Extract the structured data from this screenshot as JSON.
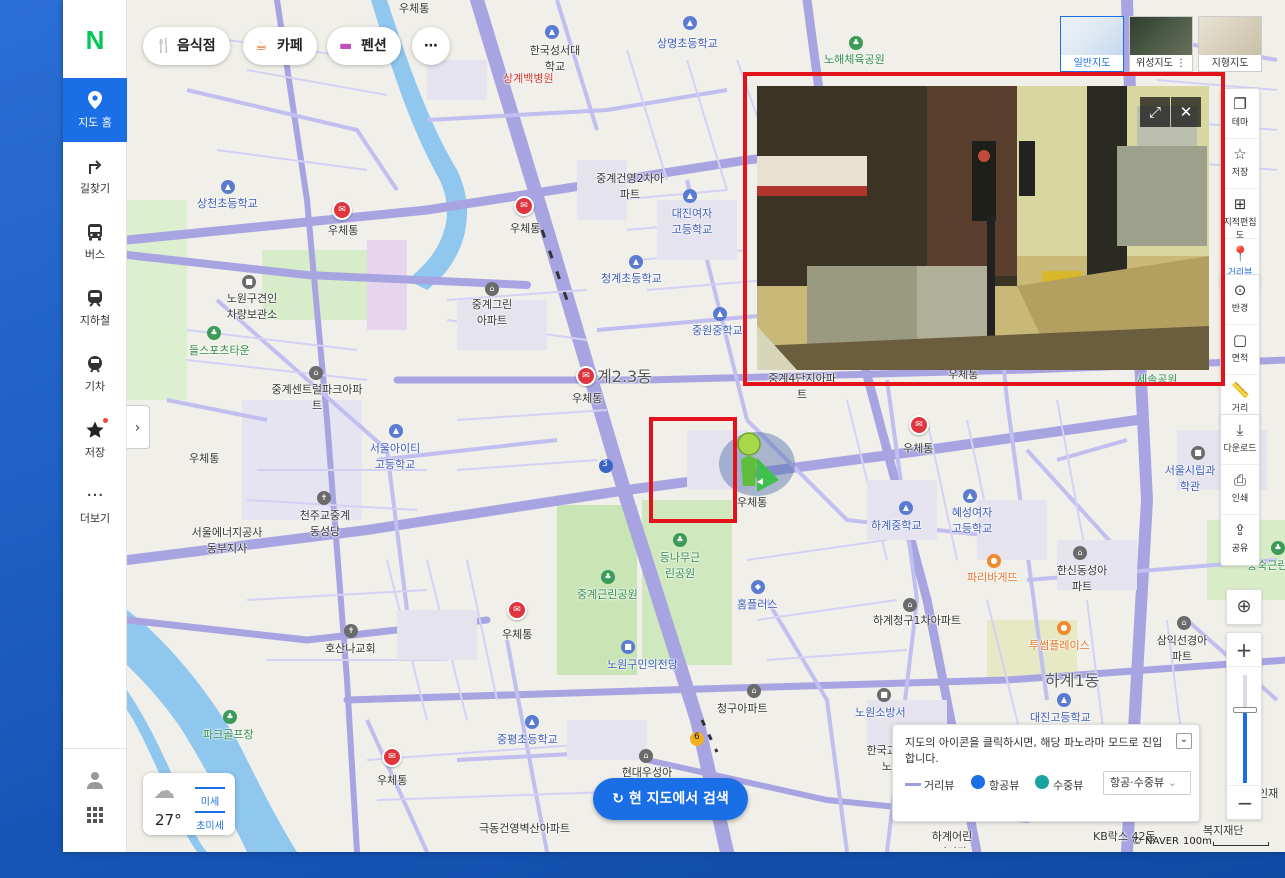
{
  "nav": {
    "logo": "N",
    "items": [
      {
        "label": "지도 홈",
        "icon": "location-pin-icon"
      },
      {
        "label": "길찾기",
        "icon": "directions-arrow-icon"
      },
      {
        "label": "버스",
        "icon": "bus-icon"
      },
      {
        "label": "지하철",
        "icon": "subway-icon"
      },
      {
        "label": "기차",
        "icon": "train-icon"
      },
      {
        "label": "저장",
        "icon": "star-icon"
      },
      {
        "label": "더보기",
        "icon": "more-dots-icon"
      }
    ]
  },
  "categories": [
    {
      "label": "음식점",
      "icon": "fork-knife-icon"
    },
    {
      "label": "카페",
      "icon": "coffee-cup-icon"
    },
    {
      "label": "펜션",
      "icon": "bed-icon"
    },
    {
      "label": "⋯",
      "icon": "more-icon"
    }
  ],
  "layers": [
    {
      "label": "일반지도",
      "active": true
    },
    {
      "label": "위성지도 ⋮",
      "active": false
    },
    {
      "label": "지형지도",
      "active": false
    }
  ],
  "tools_top": [
    {
      "label": "테마",
      "icon": "layers-icon"
    },
    {
      "label": "저장",
      "icon": "star-outline-icon"
    },
    {
      "label": "지적편집도",
      "icon": "grid-icon"
    },
    {
      "label": "거리뷰",
      "icon": "street-view-pin-icon"
    }
  ],
  "tools_measure": [
    {
      "label": "반경",
      "icon": "radius-icon"
    },
    {
      "label": "면적",
      "icon": "area-icon"
    },
    {
      "label": "거리",
      "icon": "ruler-icon"
    }
  ],
  "tools_share": [
    {
      "label": "다운로드",
      "icon": "download-icon"
    },
    {
      "label": "인쇄",
      "icon": "print-icon"
    },
    {
      "label": "공유",
      "icon": "share-icon"
    }
  ],
  "map_labels": {
    "dong_center": "계2.3동",
    "hagye1": "하계1동",
    "marker_label": "우체통",
    "post_labels": [
      "우체통",
      "우체통",
      "우체통",
      "우체통",
      "우체통",
      "우체통",
      "우체통",
      "우체통",
      "우체통"
    ],
    "places": [
      "상명초등학교",
      "한국성서대학교",
      "상계백병원",
      "노해체육공원",
      "상천초등학교",
      "중계건영2차아파트",
      "대진여자고등학교",
      "청계초등학교",
      "노원구견인차량보관소",
      "들스포츠타운",
      "중계그린아파트",
      "중원중학교",
      "중계센트럴파크아파트",
      "서울아이티고등학교",
      "천주교중계동성당",
      "서울에너지공사동부지사",
      "등나무근린공원",
      "중계근린공원",
      "홈플러스",
      "호산나교회",
      "노원구민의전당",
      "하계청구1차아파트",
      "청구아파트",
      "중평초등학교",
      "현대우성아파트",
      "극동건영벽산아파트",
      "하계중학교",
      "혜성여자고등학교",
      "파리바게뜨",
      "한신동성아파트",
      "서울시립과학관",
      "충숙근린공원",
      "투썸플레이스",
      "삼익선경아파트",
      "대진고등학교",
      "노원소방서",
      "한국교통안전공단노원검사소",
      "하계어린이서관",
      "KB락스 42동",
      "복지재단",
      "인재",
      "파크골프장",
      "세솔공원",
      "중계4단지아파트"
    ],
    "road_3": "3",
    "road_6": "6"
  },
  "weather": {
    "temp": "27°",
    "fine_dust": "미세",
    "ultra_fine_dust": "초미세"
  },
  "search_here": "현 지도에서 검색",
  "info_panel": {
    "text": "지도의 아이콘을 클릭하시면, 해당 파노라마 모드로 진입합니다.",
    "legend": [
      "거리뷰",
      "항공뷰",
      "수중뷰"
    ],
    "select": "항공·수중뷰"
  },
  "copyright": "© NAVER",
  "scale": "100m",
  "colors": {
    "accent": "#1b6fe6",
    "highlight": "#e2131b",
    "naver_green": "#03c75a",
    "road": "#b3b0e6"
  }
}
